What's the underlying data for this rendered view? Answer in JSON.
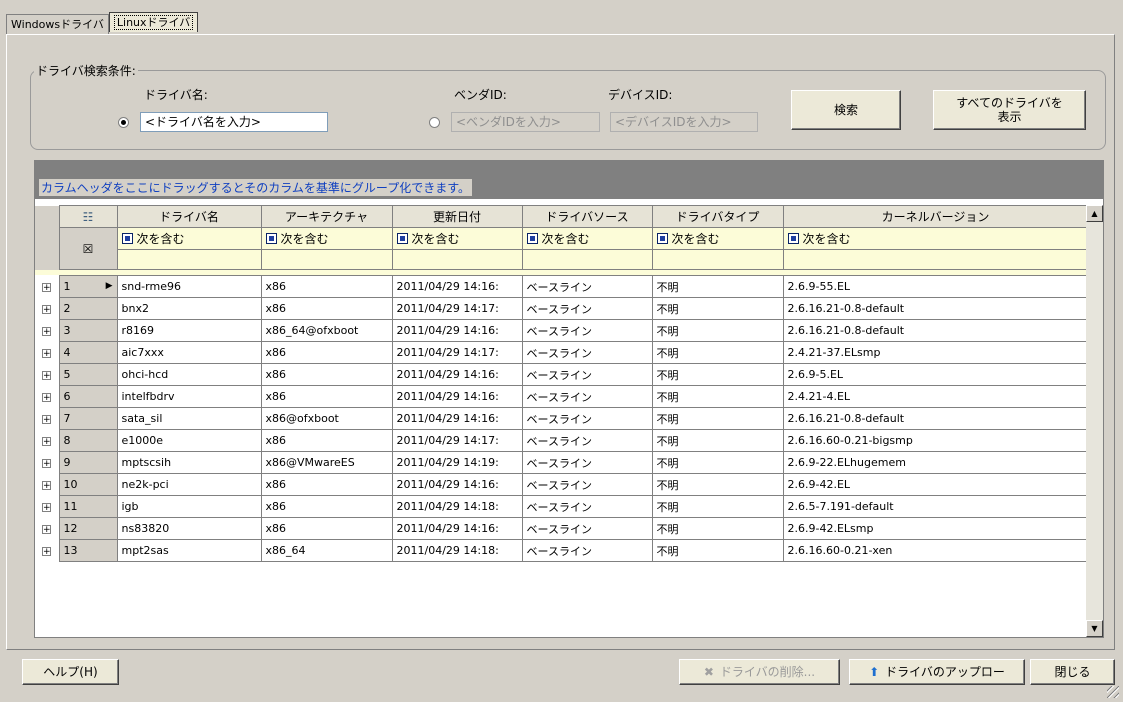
{
  "tabs": [
    "Windowsドライバ",
    "Linuxドライバ"
  ],
  "search": {
    "legend": "ドライバ検索条件:",
    "driver_name_label": "ドライバ名:",
    "driver_name_placeholder": "<ドライバ名を入力>",
    "vendor_id_label": "ベンダID:",
    "vendor_id_placeholder": "<ベンダIDを入力>",
    "device_id_label": "デバイスID:",
    "device_id_placeholder": "<デバイスIDを入力>",
    "search_button": "検索",
    "show_all_button_line1": "すべてのドライバを",
    "show_all_button_line2": "表示"
  },
  "grid": {
    "group_hint": "カラムヘッダをここにドラッグするとそのカラムを基準にグループ化できます。",
    "columns": [
      "ドライバ名",
      "アーキテクチャ",
      "更新日付",
      "ドライバソース",
      "ドライバタイプ",
      "カーネルバージョン"
    ],
    "filter_label": "次を含む",
    "rows": [
      [
        "1",
        "snd-rme96",
        "x86",
        "2011/04/29 14:16:",
        "ベースライン",
        "不明",
        "2.6.9-55.EL"
      ],
      [
        "2",
        "bnx2",
        "x86",
        "2011/04/29 14:17:",
        "ベースライン",
        "不明",
        "2.6.16.21-0.8-default"
      ],
      [
        "3",
        "r8169",
        "x86_64@ofxboot",
        "2011/04/29 14:16:",
        "ベースライン",
        "不明",
        "2.6.16.21-0.8-default"
      ],
      [
        "4",
        "aic7xxx",
        "x86",
        "2011/04/29 14:17:",
        "ベースライン",
        "不明",
        "2.4.21-37.ELsmp"
      ],
      [
        "5",
        "ohci-hcd",
        "x86",
        "2011/04/29 14:16:",
        "ベースライン",
        "不明",
        "2.6.9-5.EL"
      ],
      [
        "6",
        "intelfbdrv",
        "x86",
        "2011/04/29 14:16:",
        "ベースライン",
        "不明",
        "2.4.21-4.EL"
      ],
      [
        "7",
        "sata_sil",
        "x86@ofxboot",
        "2011/04/29 14:16:",
        "ベースライン",
        "不明",
        "2.6.16.21-0.8-default"
      ],
      [
        "8",
        "e1000e",
        "x86",
        "2011/04/29 14:17:",
        "ベースライン",
        "不明",
        "2.6.16.60-0.21-bigsmp"
      ],
      [
        "9",
        "mptscsih",
        "x86@VMwareES",
        "2011/04/29 14:19:",
        "ベースライン",
        "不明",
        "2.6.9-22.ELhugemem"
      ],
      [
        "10",
        "ne2k-pci",
        "x86",
        "2011/04/29 14:16:",
        "ベースライン",
        "不明",
        "2.6.9-42.EL"
      ],
      [
        "11",
        "igb",
        "x86",
        "2011/04/29 14:18:",
        "ベースライン",
        "不明",
        "2.6.5-7.191-default"
      ],
      [
        "12",
        "ns83820",
        "x86",
        "2011/04/29 14:16:",
        "ベースライン",
        "不明",
        "2.6.9-42.ELsmp"
      ],
      [
        "13",
        "mpt2sas",
        "x86_64",
        "2011/04/29 14:18:",
        "ベースライン",
        "不明",
        "2.6.16.60-0.21-xen"
      ]
    ]
  },
  "footer": {
    "help_button": "ヘルプ(H)",
    "delete_button": "ドライバの削除...",
    "upload_button": "ドライバのアップロー",
    "close_button": "閉じる"
  }
}
